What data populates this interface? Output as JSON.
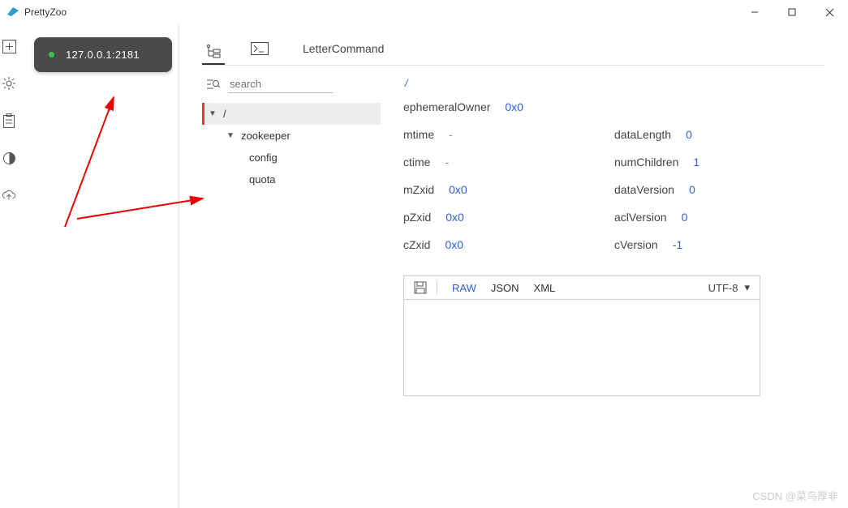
{
  "window": {
    "title": "PrettyZoo"
  },
  "sidebar": {
    "icons": [
      "add-icon",
      "gear-icon",
      "clipboard-icon",
      "contrast-icon",
      "cloud-upload-icon"
    ]
  },
  "connection": {
    "address": "127.0.0.1:2181"
  },
  "tabs": {
    "letter_label": "LetterCommand"
  },
  "search": {
    "placeholder": "search"
  },
  "tree": {
    "root": "/",
    "items": [
      {
        "label": "zookeeper"
      },
      {
        "label": "config"
      },
      {
        "label": "quota"
      }
    ]
  },
  "detail": {
    "path": "/",
    "stats_left": [
      {
        "label": "ephemeralOwner",
        "value": "0x0"
      },
      {
        "label": "mtime",
        "value": "-"
      },
      {
        "label": "ctime",
        "value": "-"
      },
      {
        "label": "mZxid",
        "value": "0x0"
      },
      {
        "label": "pZxid",
        "value": "0x0"
      },
      {
        "label": "cZxid",
        "value": "0x0"
      }
    ],
    "stats_right": [
      {
        "label": "dataLength",
        "value": "0"
      },
      {
        "label": "numChildren",
        "value": "1"
      },
      {
        "label": "dataVersion",
        "value": "0"
      },
      {
        "label": "aclVersion",
        "value": "0"
      },
      {
        "label": "cVersion",
        "value": "-1"
      }
    ],
    "formats": {
      "raw": "RAW",
      "json": "JSON",
      "xml": "XML"
    },
    "encoding": "UTF-8"
  },
  "watermark": "CSDN @菜鸟厚非"
}
